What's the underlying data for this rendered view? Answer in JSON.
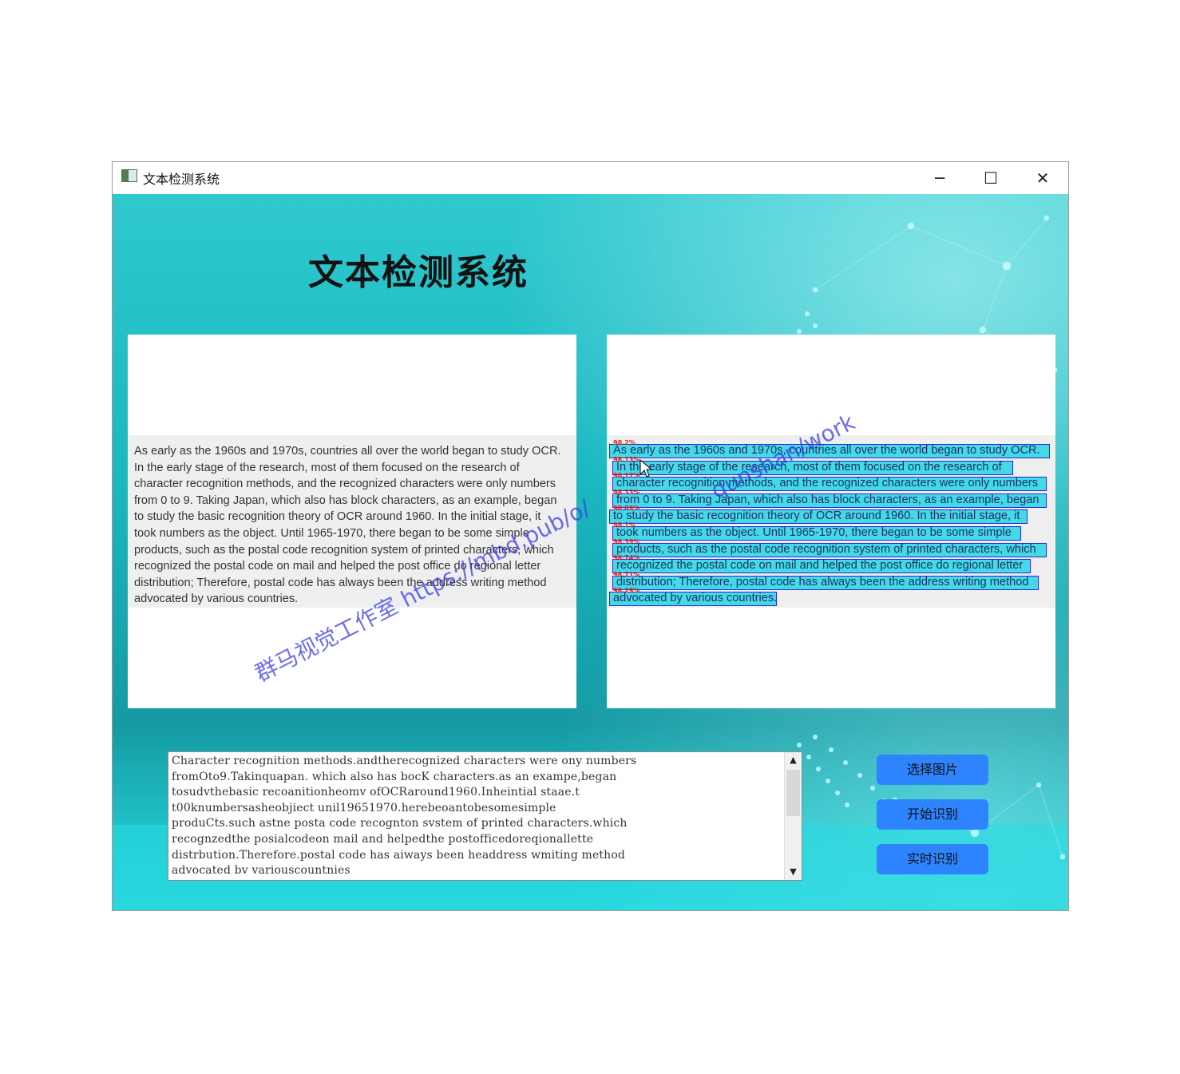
{
  "window": {
    "title": "文本检测系统",
    "controls": {
      "minimize": "─",
      "maximize": "☐",
      "close": "✕"
    }
  },
  "app": {
    "main_title": "文本检测系统"
  },
  "source_panel": {
    "lines": [
      "As early as the 1960s and 1970s, countries all over the world began to study OCR.",
      "In the early stage of the research, most of them focused on the research of",
      "character recognition methods, and the recognized characters were only numbers",
      "from 0 to 9. Taking Japan, which also has block characters, as an example, began",
      "to study the basic recognition theory of OCR around 1960. In the initial stage, it",
      "took numbers as the object. Until 1965-1970, there began to be some simple",
      "products, such as the postal code recognition system of printed characters, which",
      "recognized the postal code on mail and helped the post office do regional letter",
      "distribution; Therefore, postal code has always been the address writing method",
      "advocated by various countries."
    ]
  },
  "detection_panel": {
    "boxes": [
      {
        "text": "As early as the 1960s and 1970s, countries all over the world began to study OCR.",
        "score": "98.2%"
      },
      {
        "text": "In the early stage of the research, most of them focused on the research of",
        "score": "98.13%"
      },
      {
        "text": "character recognition methods, and the recognized characters were only numbers",
        "score": "98.17%"
      },
      {
        "text": "from 0 to 9. Taking Japan, which also has block characters, as an example, began",
        "score": "98.33%"
      },
      {
        "text": "to study the basic recognition theory of OCR around 1960. In the initial stage, it",
        "score": "98.09%"
      },
      {
        "text": "took numbers as the object. Until 1965-1970, there began to be some simple",
        "score": "98.1%"
      },
      {
        "text": "products, such as the postal code recognition system of printed characters, which",
        "score": "98.39%"
      },
      {
        "text": "recognized the postal code on mail and helped the post office do regional letter",
        "score": "98.74%"
      },
      {
        "text": "distribution; Therefore, postal code has always been the address writing method",
        "score": "98.71%"
      },
      {
        "text": "advocated by various countries.",
        "score": "98.29%"
      }
    ]
  },
  "output_box": {
    "lines": [
      "Character recognition methods.andtherecognized characters were ony numbers",
      "fromOto9.Takinquapan. which also has bocK characters.as an exampe,began",
      "tosudvthebasic recoanitionheomv ofOCRaround1960.Inheintial staae.t",
      "t00knumbersasheobjiect unil19651970.herebeoantobesomesimple",
      "produCts.such astne posta code recognton svstem of printed characters.which",
      "recognzedthe posialcodeon mail and helpedthe postofficedoreqionallette",
      "distrbution.Therefore.postal code has aiways been headdress wmiting method",
      "advocated bv variouscountnies"
    ],
    "scroll_up": "▲",
    "scroll_down": "▼"
  },
  "buttons": {
    "select_image": "选择图片",
    "start_recognition": "开始识别",
    "realtime_recognition": "实时识别"
  },
  "watermark": {
    "left": "群马视觉工作室  https://mbd.pub/o/",
    "right": "qunshan/work"
  },
  "colors": {
    "background": "#1ab8c0",
    "button": "#2e84ff",
    "detection_box_border": "#2626e0",
    "detection_box_fill": "#30d7e4",
    "score_text": "#e02020"
  }
}
